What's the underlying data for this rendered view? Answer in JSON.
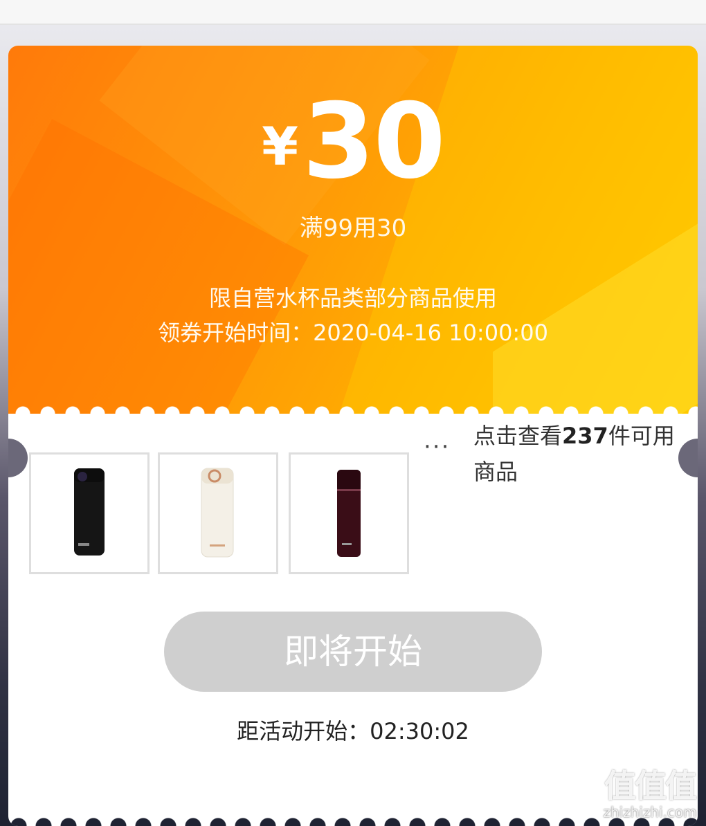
{
  "coupon": {
    "currency": "¥",
    "amount": "30",
    "condition": "满99用30",
    "scope": "限自营水杯品类部分商品使用",
    "start_time": "领券开始时间：2020-04-16 10:00:00"
  },
  "products": {
    "items": [
      {
        "name": "black thermos bottle",
        "color": "#141414"
      },
      {
        "name": "white thermos bottle",
        "color": "#f3efe6"
      },
      {
        "name": "dark red thermos bottle",
        "color": "#3a0d17"
      }
    ],
    "ellipsis": "···",
    "more_prefix": "点击查看",
    "more_count": "237",
    "more_suffix": "件可用商品"
  },
  "action": {
    "button_label": "即将开始",
    "countdown": "距活动开始：02:30:02"
  },
  "watermark": {
    "big": "值值值",
    "small": "zhizhizhi.com"
  },
  "colors": {
    "accent_orange": "#ff8a00",
    "accent_yellow": "#ffc800",
    "button_disabled": "#cfcfcf"
  }
}
